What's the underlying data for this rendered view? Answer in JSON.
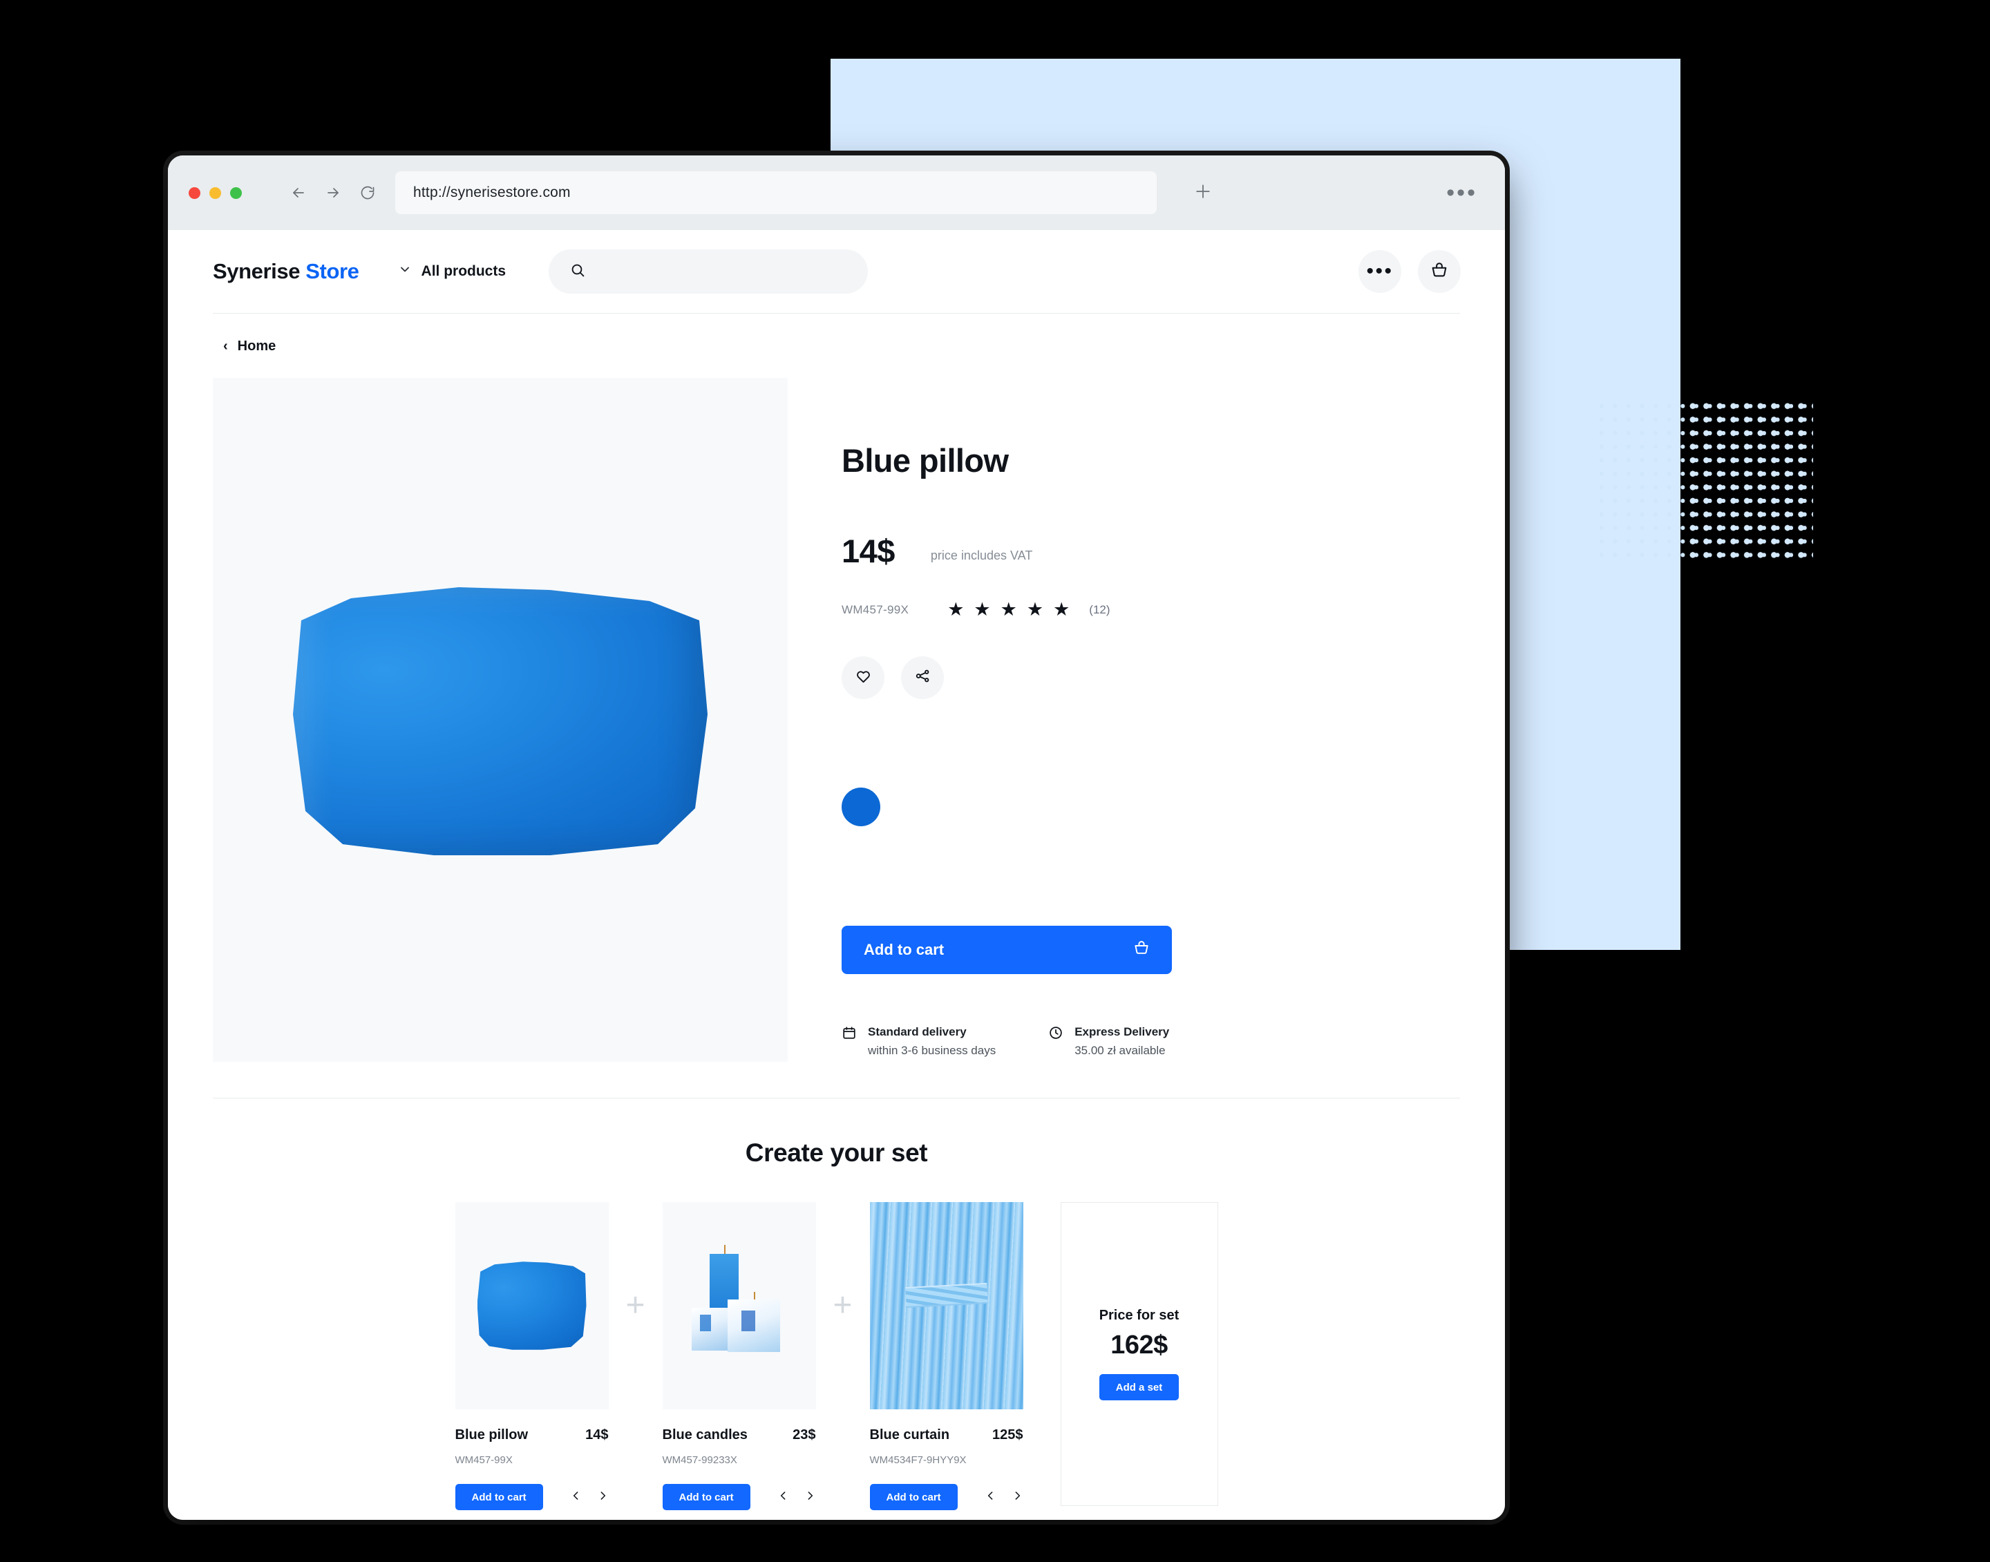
{
  "browser": {
    "url": "http://synerisestore.com",
    "new_tab_label": "+",
    "menu_label": "•••",
    "back_icon": "back-arrow-icon",
    "forward_icon": "forward-arrow-icon",
    "reload_icon": "reload-icon"
  },
  "store": {
    "logo_first": "Synerise",
    "logo_second": "Store",
    "category_label": "All products",
    "search_placeholder": "",
    "more_label": "•••"
  },
  "breadcrumb": {
    "back_chevron": "‹",
    "label": "Home"
  },
  "product": {
    "title": "Blue pillow",
    "price": "14$",
    "vat_note": "price includes VAT",
    "sku": "WM457-99X",
    "stars": 5,
    "review_count": "(12)",
    "add_to_cart": "Add to cart",
    "color_swatch": "#0c68d4",
    "delivery": [
      {
        "icon": "calendar-icon",
        "title": "Standard delivery",
        "detail": "within 3-6 business days"
      },
      {
        "icon": "clock-icon",
        "title": "Express Delivery",
        "detail": "35.00 zł available"
      }
    ]
  },
  "set": {
    "heading": "Create your set",
    "plus": "+",
    "prev": "‹",
    "next": "›",
    "items": [
      {
        "name": "Blue pillow",
        "price": "14$",
        "sku": "WM457-99X",
        "add": "Add to cart"
      },
      {
        "name": "Blue candles",
        "price": "23$",
        "sku": "WM457-99233X",
        "add": "Add to cart"
      },
      {
        "name": "Blue curtain",
        "price": "125$",
        "sku": "WM4534F7-9HYY9X",
        "add": "Add to cart"
      }
    ],
    "price_label": "Price for set",
    "price_amount": "162$",
    "add_set": "Add a set"
  },
  "colors": {
    "accent": "#1268ff",
    "logo_blue": "#0a64f4",
    "panel_blue": "#d6eaff",
    "dot_blue": "#d4e9fb",
    "text": "#10141a",
    "muted": "#7e858e"
  }
}
